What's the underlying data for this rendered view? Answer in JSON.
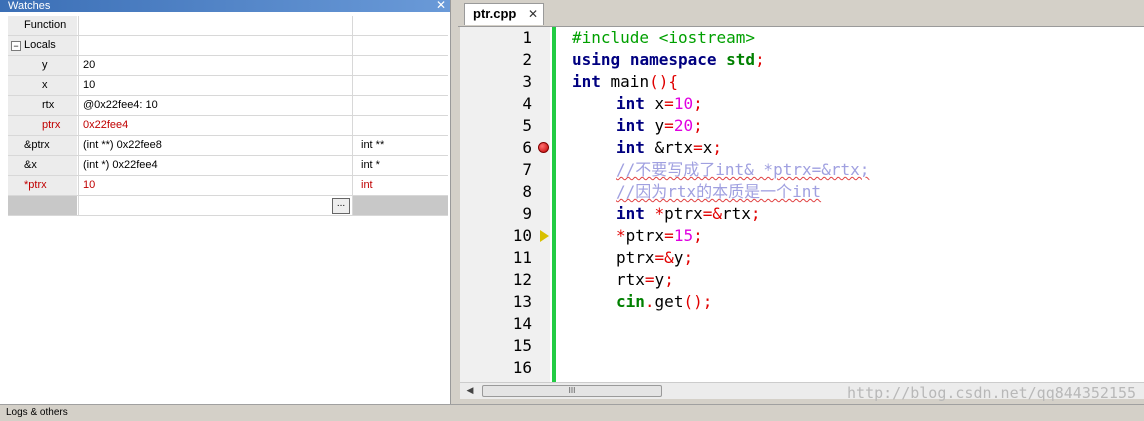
{
  "watches": {
    "title": "Watches",
    "close": "✕",
    "rows": [
      {
        "name": "Function",
        "value": "",
        "type": ""
      },
      {
        "name": "Locals",
        "value": "",
        "type": "",
        "toggle": "−"
      },
      {
        "name": "y",
        "value": "20",
        "type": ""
      },
      {
        "name": "x",
        "value": "10",
        "type": ""
      },
      {
        "name": "rtx",
        "value": "@0x22fee4: 10",
        "type": ""
      },
      {
        "name": "ptrx",
        "value": "0x22fee4",
        "type": ""
      },
      {
        "name": "&ptrx",
        "value": "(int **) 0x22fee8",
        "type": "int **"
      },
      {
        "name": "&x",
        "value": "(int *) 0x22fee4",
        "type": "int *"
      },
      {
        "name": "*ptrx",
        "value": "10",
        "type": "int"
      }
    ],
    "edit_button": "..."
  },
  "logs": {
    "label": "Logs & others"
  },
  "editor": {
    "tab_label": "ptr.cpp",
    "tab_close": "✕",
    "line_numbers": [
      "1",
      "2",
      "3",
      "4",
      "5",
      "6",
      "7",
      "8",
      "9",
      "10",
      "11",
      "12",
      "13",
      "14",
      "15",
      "16"
    ],
    "code": {
      "l1": "#include <iostream>",
      "l2_kw1": "using",
      "l2_kw2": "namespace",
      "l2_ns": "std",
      "l2_end": ";",
      "l3_kw": "int",
      "l3_rest": " main",
      "l3_sym": "(){",
      "l4_kw": "int",
      "l4_rest": " x",
      "l4_eq": "=",
      "l4_num": "10",
      "l4_end": ";",
      "l5_kw": "int",
      "l5_rest": " y",
      "l5_eq": "=",
      "l5_num": "20",
      "l5_end": ";",
      "l6_kw": "int",
      "l6_amp": " &",
      "l6_rest": "rtx",
      "l6_eq": "=",
      "l6_x": "x",
      "l6_end": ";",
      "l7": "//不要写成了int& *ptrx=&rtx;",
      "l8": "//因为rtx的本质是一个int",
      "l9_kw": "int",
      "l9_star": " *",
      "l9_rest": "ptrx",
      "l9_eq": "=&",
      "l9_v": "rtx",
      "l9_end": ";",
      "l10_star": "*",
      "l10_rest": "ptrx",
      "l10_eq": "=",
      "l10_num": "15",
      "l10_end": ";",
      "l11_rest": "ptrx",
      "l11_eq": "=&",
      "l11_v": "y",
      "l11_end": ";",
      "l12_rest": "rtx",
      "l12_eq": "=",
      "l12_v": "y",
      "l12_end": ";",
      "l13_cin": "cin",
      "l13_dot": ".",
      "l13_get": "get",
      "l13_end": "();"
    },
    "breakpoint_line": "6",
    "current_line": "10",
    "scroll_thumb": "III"
  },
  "watermark": "http://blog.csdn.net/qq844352155",
  "colors": {
    "keyword": "#000080",
    "namespace": "#008000",
    "number": "#e000e0",
    "symbol": "#e00000",
    "comment": "#a0a0e0",
    "gutter_bar": "#22cc44"
  }
}
